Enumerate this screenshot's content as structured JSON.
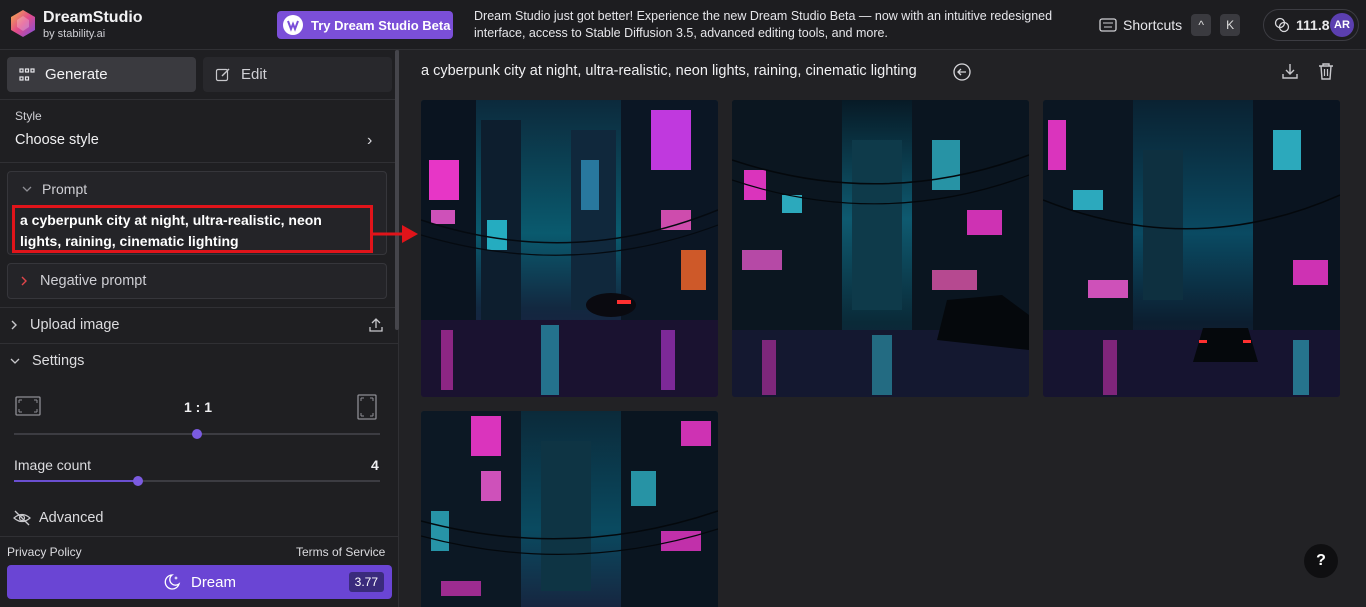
{
  "header": {
    "brand_name": "DreamStudio",
    "brand_sub": "by stability.ai",
    "beta_button": "Try Dream Studio Beta",
    "announcement": "Dream Studio just got better! Experience the new Dream Studio Beta — now with an intuitive redesigned interface, access to Stable Diffusion 3.5, advanced editing tools, and more.",
    "shortcuts_label": "Shortcuts",
    "shortcut_keys": [
      "^",
      "K"
    ],
    "credits": "111.8",
    "avatar_initials": "AR",
    "icons": [
      "stability-logo-icon",
      "beta-logo-icon",
      "keyboard-icon",
      "coins-icon"
    ]
  },
  "sidebar": {
    "tabs": [
      {
        "label": "Generate",
        "active": true,
        "icon": "grid-icon"
      },
      {
        "label": "Edit",
        "active": false,
        "icon": "edit-icon"
      }
    ],
    "style": {
      "label": "Style",
      "value": "Choose style"
    },
    "prompt": {
      "title": "Prompt",
      "text": "a cyberpunk city at night, ultra-realistic, neon lights, raining, cinematic lighting"
    },
    "negative_prompt": "Negative prompt",
    "upload_image": "Upload image",
    "settings": {
      "title": "Settings",
      "aspect_ratio": "1 : 1",
      "aspect_ratio_position": 0.5,
      "image_count_label": "Image count",
      "image_count": "4",
      "image_count_fraction": 0.34
    },
    "advanced": "Advanced",
    "privacy_policy": "Privacy Policy",
    "terms": "Terms of Service",
    "dream_button": "Dream",
    "dream_cost": "3.77"
  },
  "main": {
    "title": "a cyberpunk city at night, ultra-realistic, neon lights, raining, cinematic lighting",
    "help": "?",
    "images": [
      {
        "name": "result-image-1"
      },
      {
        "name": "result-image-2"
      },
      {
        "name": "result-image-3"
      },
      {
        "name": "result-image-4"
      }
    ]
  },
  "colors": {
    "accent": "#6a45d4",
    "highlight": "#e0141a",
    "background": "#222225"
  }
}
